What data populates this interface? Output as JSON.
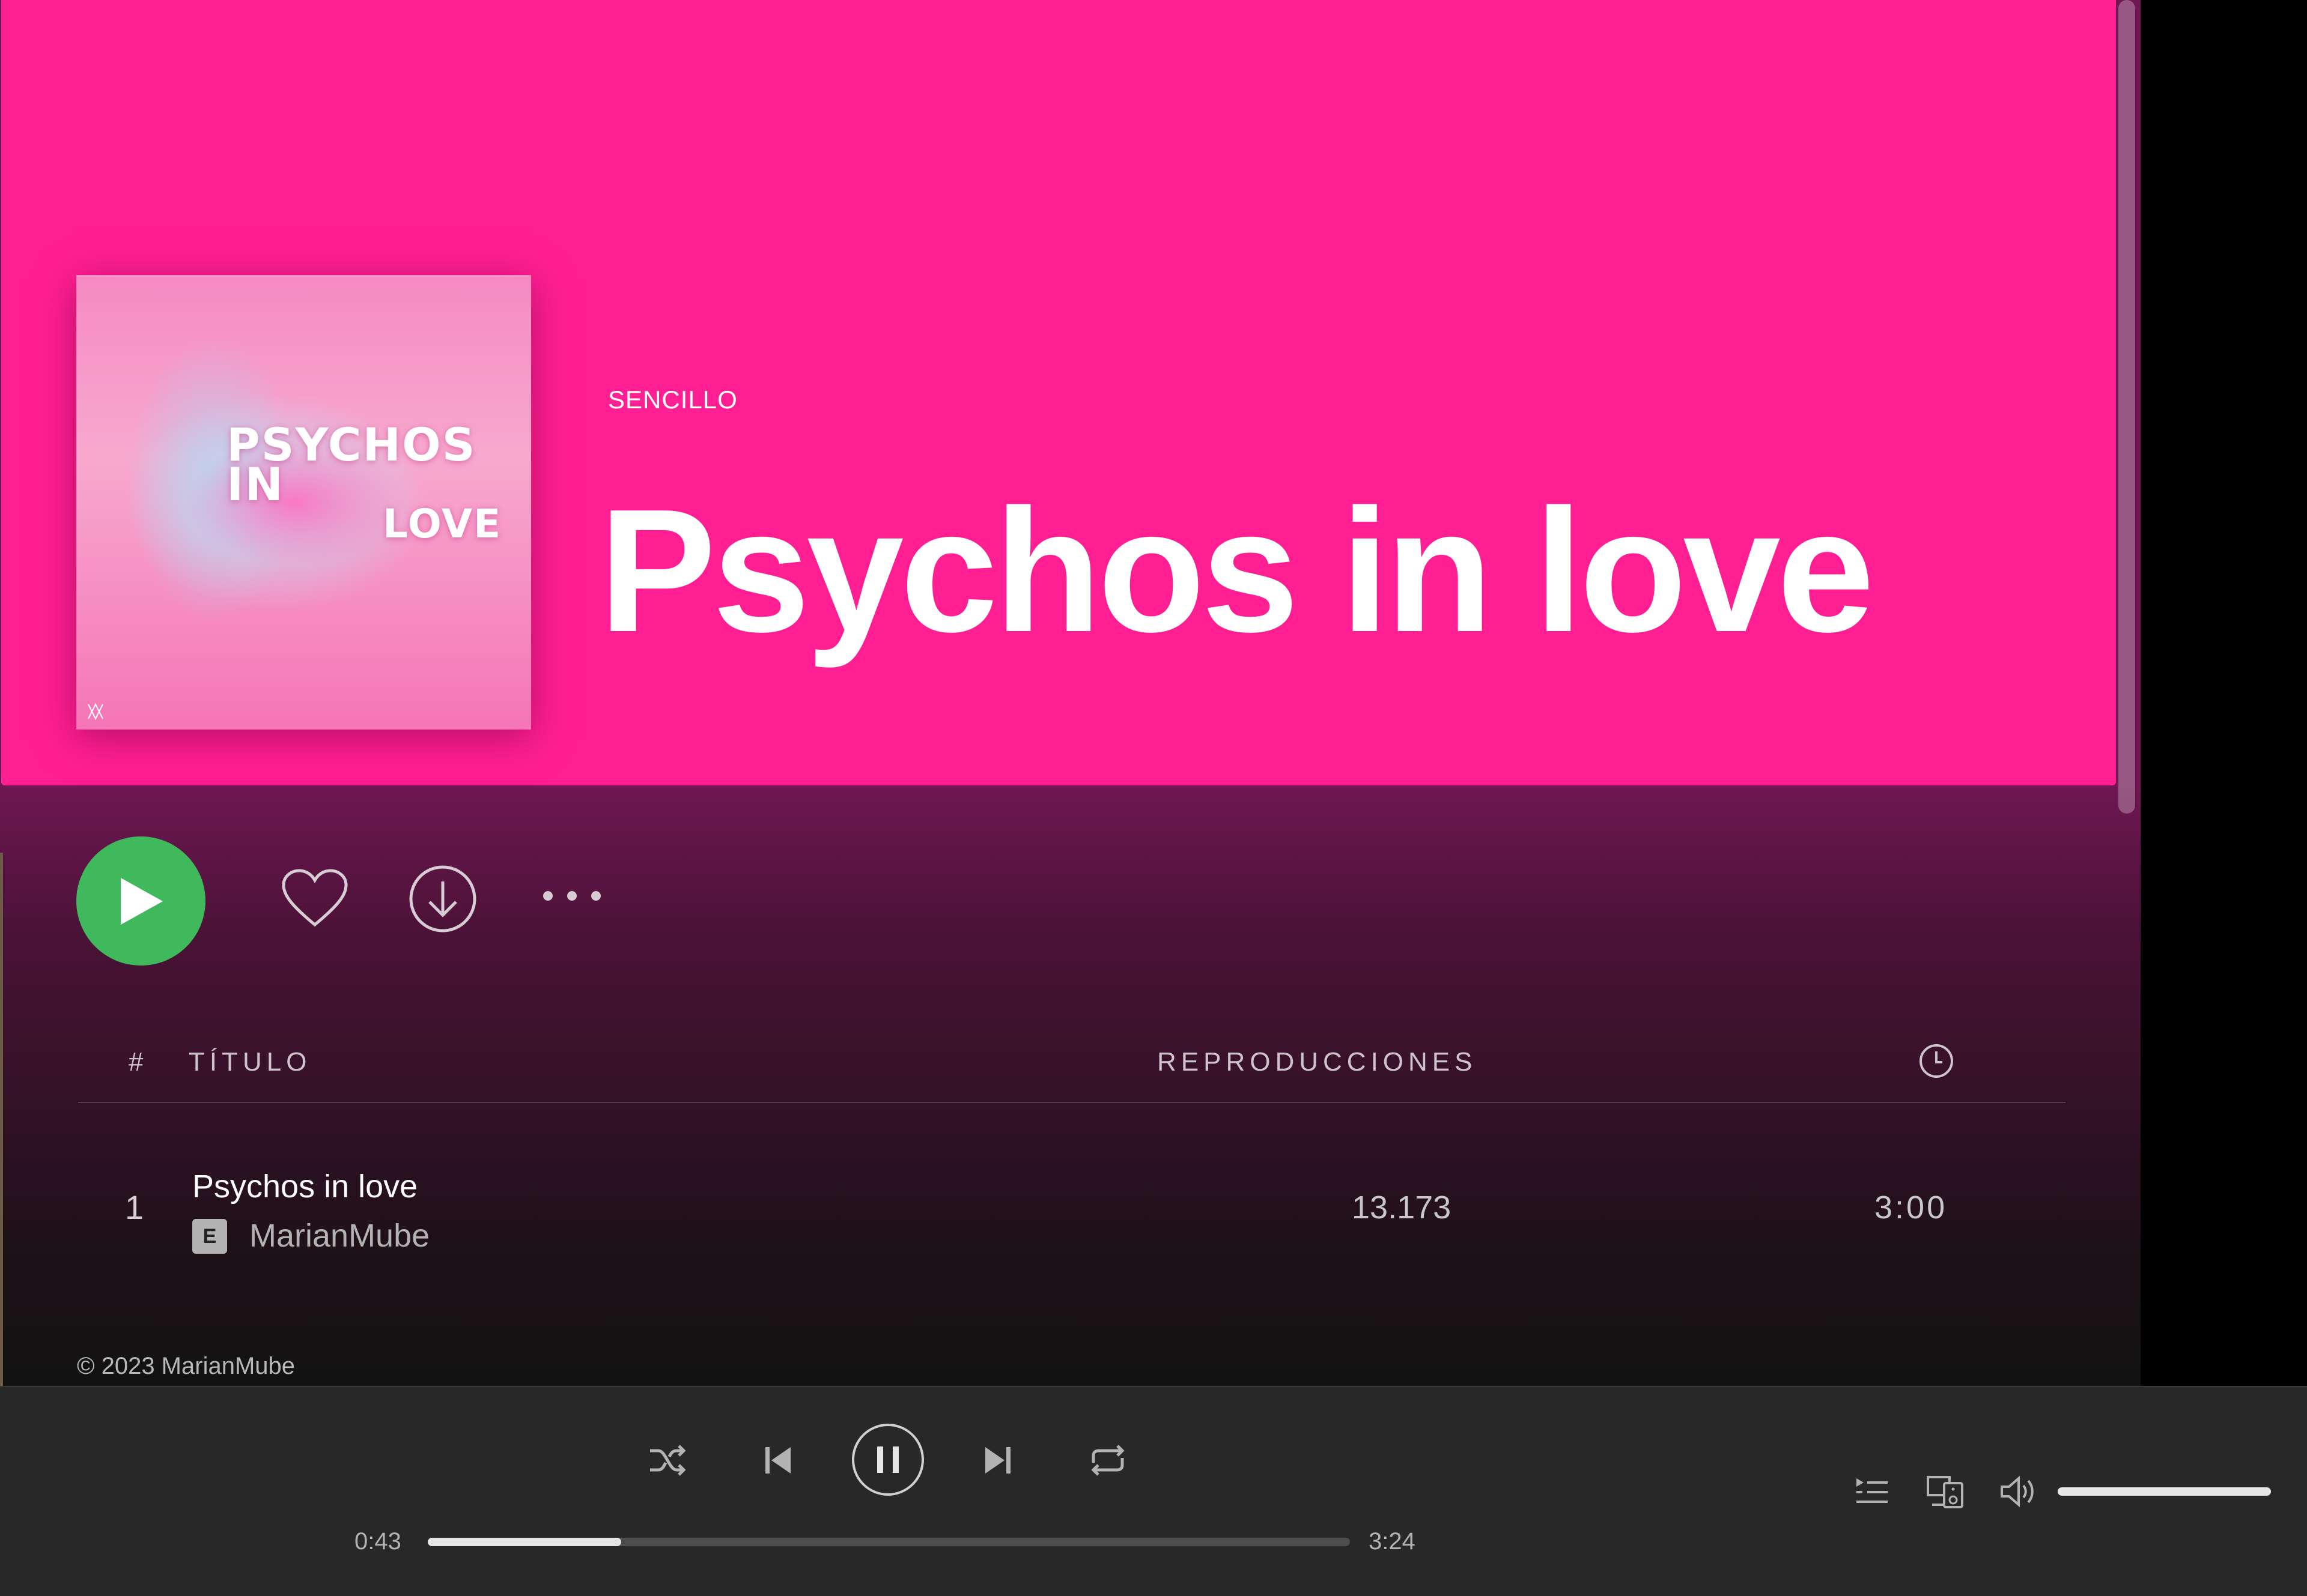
{
  "album": {
    "type_label": "SENCILLO",
    "title": "Psychos in love",
    "cover_text_line1": "PSYCHOS IN",
    "cover_text_line2": "LOVE"
  },
  "action_bar": {
    "play_icon": "play-icon",
    "like_icon": "heart-icon",
    "download_icon": "download-icon",
    "more_icon": "more-options-icon"
  },
  "table": {
    "headers": {
      "number": "#",
      "title": "TÍTULO",
      "plays": "REPRODUCCIONES",
      "duration_icon": "clock-icon"
    },
    "rows": [
      {
        "number": "1",
        "title": "Psychos in love",
        "explicit": "E",
        "artist": "MarianMube",
        "plays": "13.173",
        "duration": "3:00"
      }
    ]
  },
  "copyright": "© 2023  MarianMube",
  "player": {
    "current_time": "0:43",
    "total_time": "3:24",
    "progress_fraction": 0.21,
    "volume_fraction": 1.0,
    "icons": [
      "shuffle-icon",
      "previous-icon",
      "pause-icon",
      "next-icon",
      "repeat-icon",
      "queue-icon",
      "devices-icon",
      "volume-icon"
    ]
  },
  "colors": {
    "hero": "#ff1f93",
    "play_button": "#3fb95c",
    "player_bar": "#282828"
  }
}
